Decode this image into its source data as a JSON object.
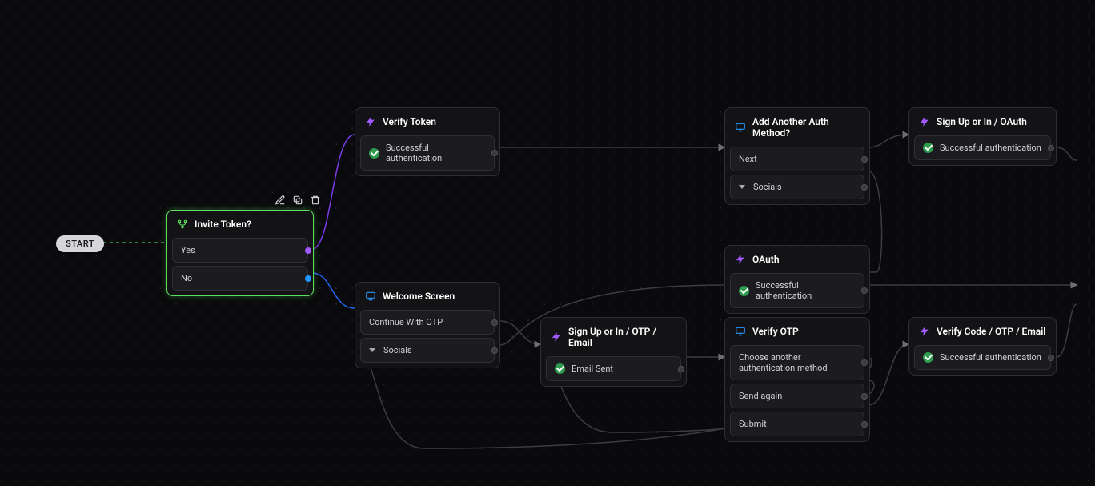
{
  "start_label": "START",
  "toolbar": {
    "edit": "Edit",
    "duplicate": "Duplicate",
    "delete": "Delete"
  },
  "nodes": {
    "invite_token": {
      "title": "Invite Token?",
      "icon": "branch",
      "items": [
        {
          "label": "Yes"
        },
        {
          "label": "No"
        }
      ]
    },
    "verify_token": {
      "title": "Verify Token",
      "icon": "bolt",
      "items": [
        {
          "label": "Successful authentication",
          "status": "success"
        }
      ]
    },
    "welcome_screen": {
      "title": "Welcome Screen",
      "icon": "screen",
      "items": [
        {
          "label": "Continue With OTP"
        },
        {
          "label": "Socials",
          "expandable": true
        }
      ]
    },
    "add_another": {
      "title": "Add Another Auth Method?",
      "icon": "screen",
      "items": [
        {
          "label": "Next"
        },
        {
          "label": "Socials",
          "expandable": true
        }
      ]
    },
    "signup_oauth": {
      "title": "Sign Up or In / OAuth",
      "icon": "bolt",
      "items": [
        {
          "label": "Successful authentication",
          "status": "success"
        }
      ]
    },
    "oauth": {
      "title": "OAuth",
      "icon": "bolt",
      "items": [
        {
          "label": "Successful authentication",
          "status": "success"
        }
      ]
    },
    "signup_otp_email": {
      "title": "Sign Up or In / OTP / Email",
      "icon": "bolt",
      "items": [
        {
          "label": "Email Sent",
          "status": "success"
        }
      ]
    },
    "verify_otp": {
      "title": "Verify OTP",
      "icon": "screen",
      "items": [
        {
          "label": "Choose another authentication method"
        },
        {
          "label": "Send again"
        },
        {
          "label": "Submit"
        }
      ]
    },
    "verify_code": {
      "title": "Verify Code / OTP / Email",
      "icon": "bolt",
      "items": [
        {
          "label": "Successful authentication",
          "status": "success"
        }
      ]
    }
  }
}
